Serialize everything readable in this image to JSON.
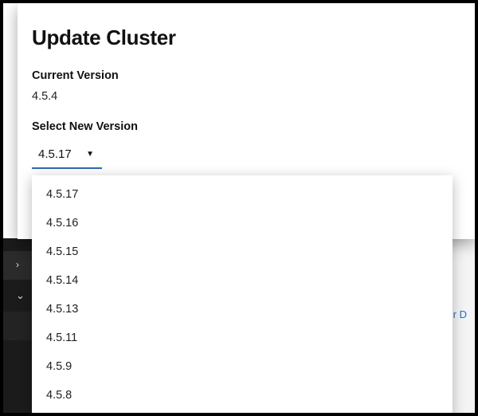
{
  "modal": {
    "title": "Update Cluster",
    "current_version_label": "Current Version",
    "current_version_value": "4.5.4",
    "select_new_label": "Select New Version",
    "selected_version": "4.5.17"
  },
  "dropdown_options": [
    "4.5.17",
    "4.5.16",
    "4.5.15",
    "4.5.14",
    "4.5.13",
    "4.5.11",
    "4.5.9",
    "4.5.8"
  ],
  "background": {
    "link_fragment": "ager D"
  }
}
